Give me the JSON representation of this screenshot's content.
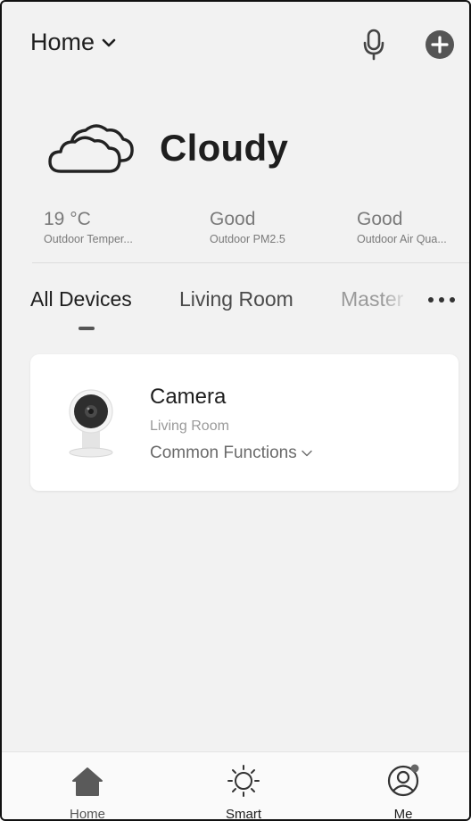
{
  "header": {
    "home_label": "Home",
    "mic_icon": "microphone-icon",
    "add_icon": "plus-circle-icon"
  },
  "weather": {
    "condition": "Cloudy",
    "icon": "cloud-icon",
    "stats": [
      {
        "value": "19 °C",
        "label": "Outdoor Temper..."
      },
      {
        "value": "Good",
        "label": "Outdoor PM2.5"
      },
      {
        "value": "Good",
        "label": "Outdoor Air Qua..."
      }
    ]
  },
  "tabs": {
    "items": [
      {
        "label": "All Devices",
        "active": true
      },
      {
        "label": "Living Room",
        "active": false
      },
      {
        "label": "Master",
        "active": false
      }
    ],
    "more_icon": "more-horizontal-icon"
  },
  "device": {
    "name": "Camera",
    "room": "Living Room",
    "functions_label": "Common Functions",
    "image_icon": "camera-device-icon"
  },
  "bottom_nav": {
    "items": [
      {
        "label": "Home",
        "icon": "home-icon",
        "active": true
      },
      {
        "label": "Smart",
        "icon": "sun-icon",
        "active": false
      },
      {
        "label": "Me",
        "icon": "user-circle-icon",
        "active": false,
        "notification_dot": true
      }
    ]
  },
  "colors": {
    "background": "#f2f2f2",
    "card": "#ffffff",
    "text_primary": "#1e1e1e",
    "text_secondary": "#7a7a7a",
    "icon": "#555555"
  }
}
